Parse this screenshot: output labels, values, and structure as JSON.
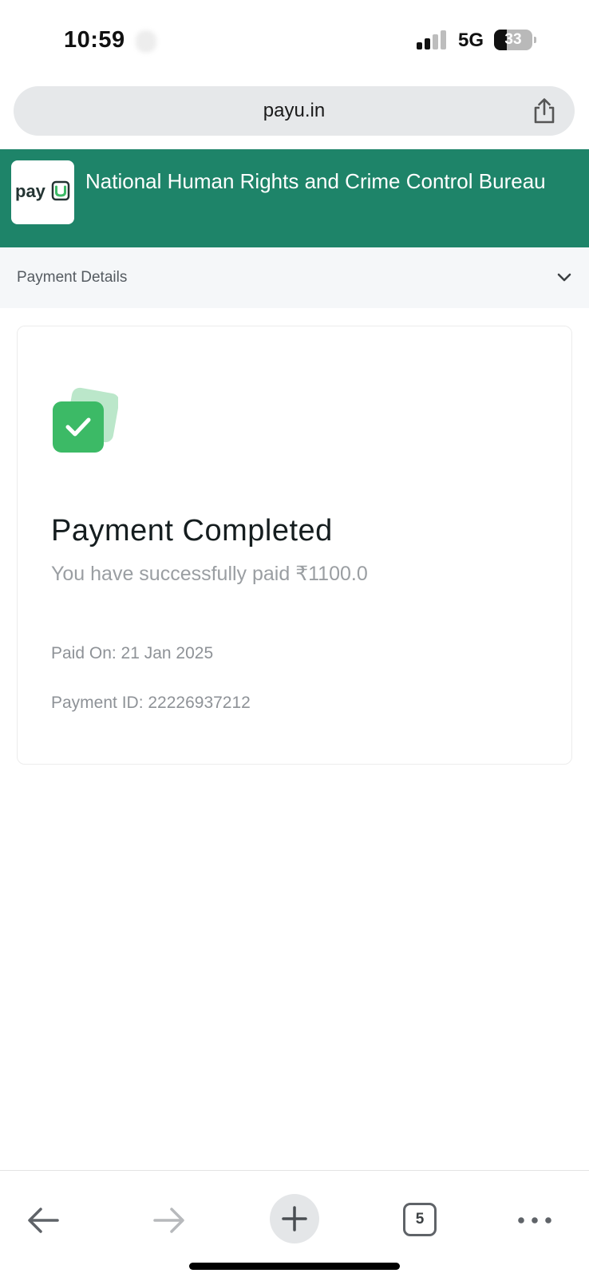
{
  "status_bar": {
    "time": "10:59",
    "network": "5G",
    "battery": "33",
    "battery_level": 0.33,
    "signal_bars_active": 2,
    "signal_bars_total": 4
  },
  "browser": {
    "url": "payu.in",
    "tabs_count": "5"
  },
  "merchant": {
    "logo_text": "payu",
    "name": "National Human Rights and Crime Control Bureau",
    "brand_color": "#1e8469"
  },
  "details": {
    "label": "Payment Details"
  },
  "payment": {
    "title": "Payment Completed",
    "subtitle": "You have successfully paid ₹1100.0",
    "paid_on": "Paid On: 21 Jan 2025",
    "payment_id": "Payment ID: 22226937212",
    "success_color": "#3cba66"
  },
  "icons": {
    "share": "share-icon",
    "chevron": "chevron-down-icon",
    "back": "back-arrow-icon",
    "forward": "forward-arrow-icon",
    "new_tab": "plus-icon",
    "more": "more-dots-icon",
    "success": "check-badge-icon"
  }
}
